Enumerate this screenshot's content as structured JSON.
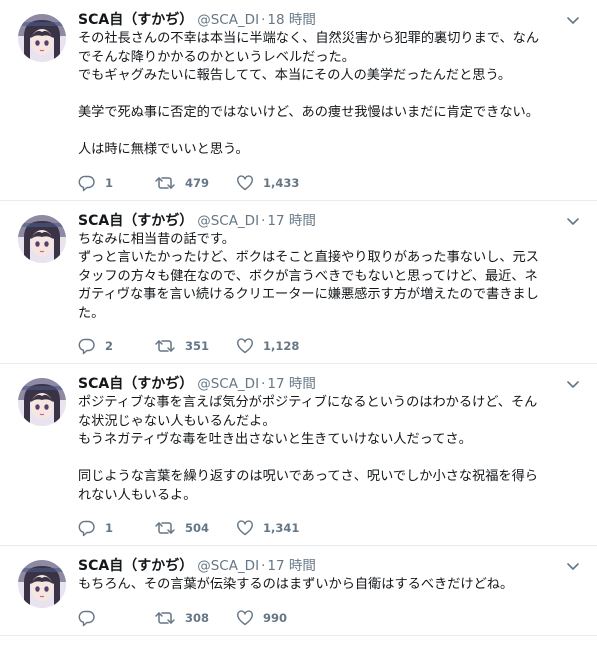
{
  "tweets": [
    {
      "name": "SCA自（すかぢ）",
      "handle": "@SCA_DI",
      "sep": "·",
      "time": "18 時間",
      "lines": [
        "その社長さんの不幸は本当に半端なく、自然災害から犯罪的裏切りまで、なん",
        "でそんな降りかかるのかというレベルだった。",
        "でもギャグみたいに報告してて、本当にその人の美学だったんだと思う。",
        "",
        "美学で死ぬ事に否定的ではないけど、あの痩せ我慢はいまだに肯定できない。",
        "",
        "人は時に無様でいいと思う。"
      ],
      "replies": "1",
      "retweets": "479",
      "likes": "1,433"
    },
    {
      "name": "SCA自（すかぢ）",
      "handle": "@SCA_DI",
      "sep": "·",
      "time": "17 時間",
      "lines": [
        "ちなみに相当昔の話です。",
        "ずっと言いたかったけど、ボクはそこと直接やり取りがあった事ないし、元ス",
        "タッフの方々も健在なので、ボクが言うべきでもないと思ってけど、最近、ネ",
        "ガティヴな事を言い続けるクリエーターに嫌悪感示す方が増えたので書きまし",
        "た。"
      ],
      "replies": "2",
      "retweets": "351",
      "likes": "1,128"
    },
    {
      "name": "SCA自（すかぢ）",
      "handle": "@SCA_DI",
      "sep": "·",
      "time": "17 時間",
      "lines": [
        "ポジティブな事を言えば気分がポジティブになるというのはわかるけど、そん",
        "な状況じゃない人もいるんだよ。",
        "もうネガティヴな毒を吐き出さないと生きていけない人だってさ。",
        "",
        "同じような言葉を繰り返すのは呪いであってさ、呪いでしか小さな祝福を得ら",
        "れない人もいるよ。"
      ],
      "replies": "1",
      "retweets": "504",
      "likes": "1,341"
    },
    {
      "name": "SCA自（すかぢ）",
      "handle": "@SCA_DI",
      "sep": "·",
      "time": "17 時間",
      "lines": [
        "もちろん、その言葉が伝染するのはまずいから自衛はするべきだけどね。"
      ],
      "replies": "",
      "retweets": "308",
      "likes": "990"
    }
  ],
  "icons": {
    "reply": "reply-icon",
    "retweet": "retweet-icon",
    "like": "heart-icon",
    "caret": "chevron-down-icon",
    "avatar": "avatar"
  },
  "colors": {
    "text": "#14171a",
    "secondary": "#657786",
    "divider": "#e6ecf0"
  }
}
